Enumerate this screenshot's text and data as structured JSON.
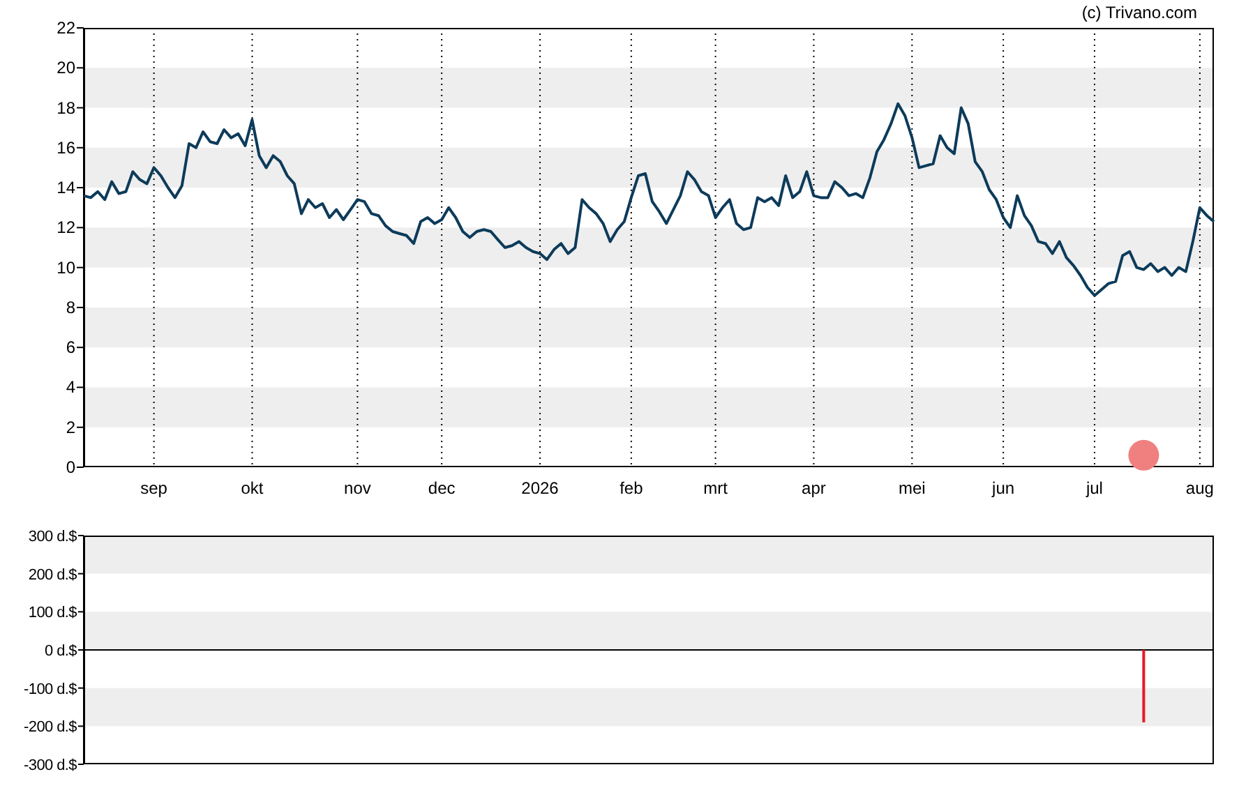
{
  "credit": "(c) Trivano.com",
  "price_chart": {
    "chart_data": {
      "type": "line",
      "ylim": [
        0,
        22
      ],
      "yticks": [
        0,
        2,
        4,
        6,
        8,
        10,
        12,
        14,
        16,
        18,
        20,
        22
      ],
      "categories": [
        null,
        null,
        null,
        null,
        null,
        null,
        null,
        null,
        null,
        null,
        "sep",
        null,
        null,
        null,
        null,
        null,
        null,
        null,
        null,
        null,
        null,
        null,
        null,
        null,
        "okt",
        null,
        null,
        null,
        null,
        null,
        null,
        null,
        null,
        null,
        null,
        null,
        null,
        null,
        null,
        "nov",
        null,
        null,
        null,
        null,
        null,
        null,
        null,
        null,
        null,
        null,
        null,
        "dec",
        null,
        null,
        null,
        null,
        null,
        null,
        null,
        null,
        null,
        null,
        null,
        null,
        null,
        "2026",
        null,
        null,
        null,
        null,
        null,
        null,
        null,
        null,
        null,
        null,
        null,
        null,
        "feb",
        null,
        null,
        null,
        null,
        null,
        null,
        null,
        null,
        null,
        null,
        null,
        "mrt",
        null,
        null,
        null,
        null,
        null,
        null,
        null,
        null,
        null,
        null,
        null,
        null,
        null,
        "apr",
        null,
        null,
        null,
        null,
        null,
        null,
        null,
        null,
        null,
        null,
        null,
        null,
        null,
        "mei",
        null,
        null,
        null,
        null,
        null,
        null,
        null,
        null,
        null,
        null,
        null,
        null,
        "jun",
        null,
        null,
        null,
        null,
        null,
        null,
        null,
        null,
        null,
        null,
        null,
        null,
        "jul",
        null,
        null,
        null,
        null,
        null,
        null,
        null,
        null,
        null,
        null,
        null,
        null,
        null,
        null,
        "aug",
        null,
        null
      ],
      "series": [
        {
          "color": "#0d3b5a",
          "values": [
            13.6,
            13.5,
            13.8,
            13.4,
            14.3,
            13.7,
            13.8,
            14.8,
            14.4,
            14.2,
            15.0,
            14.6,
            14.0,
            13.5,
            14.1,
            16.2,
            16.0,
            16.8,
            16.3,
            16.2,
            16.9,
            16.5,
            16.7,
            16.1,
            17.4,
            15.6,
            15.0,
            15.6,
            15.3,
            14.6,
            14.2,
            12.7,
            13.4,
            13.0,
            13.2,
            12.5,
            12.9,
            12.4,
            12.9,
            13.4,
            13.3,
            12.7,
            12.6,
            12.1,
            11.8,
            11.7,
            11.6,
            11.2,
            12.3,
            12.5,
            12.2,
            12.4,
            13.0,
            12.5,
            11.8,
            11.5,
            11.8,
            11.9,
            11.8,
            11.4,
            11.0,
            11.1,
            11.3,
            11.0,
            10.8,
            10.7,
            10.4,
            10.9,
            11.2,
            10.7,
            11.0,
            13.4,
            13.0,
            12.7,
            12.2,
            11.3,
            11.9,
            12.3,
            13.5,
            14.6,
            14.7,
            13.3,
            12.8,
            12.2,
            12.9,
            13.6,
            14.8,
            14.4,
            13.8,
            13.6,
            12.5,
            13.0,
            13.4,
            12.2,
            11.9,
            12.0,
            13.5,
            13.3,
            13.5,
            13.1,
            14.6,
            13.5,
            13.8,
            14.8,
            13.6,
            13.5,
            13.5,
            14.3,
            14.0,
            13.6,
            13.7,
            13.5,
            14.5,
            15.8,
            16.4,
            17.2,
            18.2,
            17.6,
            16.5,
            15.0,
            15.1,
            15.2,
            16.6,
            16.0,
            15.7,
            18.0,
            17.2,
            15.3,
            14.8,
            13.9,
            13.4,
            12.5,
            12.0,
            13.6,
            12.6,
            12.1,
            11.3,
            11.2,
            10.7,
            11.3,
            10.5,
            10.1,
            9.6,
            9.0,
            8.6,
            8.9,
            9.2,
            9.3,
            10.6,
            10.8,
            10.0,
            9.9,
            10.2,
            9.8,
            10.0,
            9.6,
            10.0,
            9.8,
            11.3,
            13.0,
            12.6,
            12.3
          ]
        }
      ]
    }
  },
  "event_marker": {
    "color": "#f08080"
  },
  "flow_chart": {
    "chart_data": {
      "type": "bar",
      "ylim": [
        -300,
        300
      ],
      "yticks": [
        {
          "value": 300,
          "label": "300 d.$"
        },
        {
          "value": 200,
          "label": "200 d.$"
        },
        {
          "value": 100,
          "label": "100 d.$"
        },
        {
          "value": 0,
          "label": "0 d.$"
        },
        {
          "value": -100,
          "label": "-100 d.$"
        },
        {
          "value": -200,
          "label": "-200 d.$"
        },
        {
          "value": -300,
          "label": "-300 d.$"
        }
      ],
      "categories": [
        null,
        null,
        null,
        null,
        null,
        null,
        null,
        null,
        null,
        null,
        null,
        null,
        null,
        null,
        null,
        null,
        null,
        null,
        null,
        null,
        null,
        null,
        null,
        null,
        null,
        null,
        null,
        null,
        null,
        null,
        null,
        null,
        null,
        null,
        null,
        null,
        null,
        null,
        null,
        null,
        null,
        null,
        null,
        null,
        null,
        null,
        null,
        null,
        null,
        null,
        null,
        null,
        null,
        null,
        null,
        null,
        null,
        null,
        null,
        null,
        null,
        null,
        null,
        null,
        null,
        null,
        null,
        null,
        null,
        null,
        null,
        null,
        null,
        null,
        null,
        null,
        null,
        null,
        null,
        null,
        null,
        null,
        null,
        null,
        null,
        null,
        null,
        null,
        null,
        null,
        null,
        null,
        null,
        null,
        null,
        null,
        null,
        null,
        null,
        null,
        null,
        null,
        null,
        null,
        null,
        null,
        null,
        null,
        null,
        null,
        null,
        null,
        null,
        null,
        null,
        null,
        null,
        null,
        null,
        null,
        null,
        null,
        null,
        null,
        null,
        null,
        null,
        null,
        null,
        null,
        null,
        null,
        null,
        null,
        null,
        null,
        null,
        null,
        null,
        null,
        null,
        null,
        null,
        null,
        null,
        null,
        null,
        null,
        null,
        null,
        null,
        null,
        null,
        null,
        null,
        null,
        null,
        null,
        null,
        null,
        null,
        null
      ],
      "series": [
        {
          "color": "#e8192c",
          "values": [
            null,
            null,
            null,
            null,
            null,
            null,
            null,
            null,
            null,
            null,
            null,
            null,
            null,
            null,
            null,
            null,
            null,
            null,
            null,
            null,
            null,
            null,
            null,
            null,
            null,
            null,
            null,
            null,
            null,
            null,
            null,
            null,
            null,
            null,
            null,
            null,
            null,
            null,
            null,
            null,
            null,
            null,
            null,
            null,
            null,
            null,
            null,
            null,
            null,
            null,
            null,
            null,
            null,
            null,
            null,
            null,
            null,
            null,
            null,
            null,
            null,
            null,
            null,
            null,
            null,
            null,
            null,
            null,
            null,
            null,
            null,
            null,
            null,
            null,
            null,
            null,
            null,
            null,
            null,
            null,
            null,
            null,
            null,
            null,
            null,
            null,
            null,
            null,
            null,
            null,
            null,
            null,
            null,
            null,
            null,
            null,
            null,
            null,
            null,
            null,
            null,
            null,
            null,
            null,
            null,
            null,
            null,
            null,
            null,
            null,
            null,
            null,
            null,
            null,
            null,
            null,
            null,
            null,
            null,
            null,
            null,
            null,
            null,
            null,
            null,
            null,
            null,
            null,
            null,
            null,
            null,
            null,
            null,
            null,
            null,
            null,
            null,
            null,
            null,
            null,
            null,
            null,
            null,
            null,
            null,
            null,
            null,
            null,
            null,
            null,
            null,
            -190,
            null,
            null,
            null,
            null,
            null,
            null,
            null,
            null,
            null,
            null
          ]
        }
      ]
    }
  }
}
